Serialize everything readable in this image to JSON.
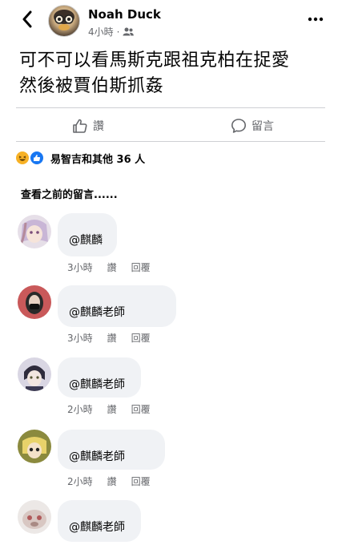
{
  "header": {
    "author": "Noah Duck",
    "time": "4小時",
    "privacy_icon": "friends-icon"
  },
  "post": {
    "text": "可不可以看馬斯克跟祖克柏在捉愛\n然後被賈伯斯抓姦"
  },
  "actions": {
    "like_label": "讚",
    "comment_label": "留言"
  },
  "reactions": {
    "icons": [
      "haha-icon",
      "like-icon"
    ],
    "text": "易智吉和其他 36 人"
  },
  "comments_section": {
    "view_previous": "查看之前的留言......"
  },
  "comments": [
    {
      "name": "",
      "text": "@麒麟",
      "time": "3小時",
      "like": "讚",
      "reply": "回覆"
    },
    {
      "name": "",
      "text": "@麒麟老師",
      "time": "3小時",
      "like": "讚",
      "reply": "回覆"
    },
    {
      "name": "",
      "text": "@麒麟老師",
      "time": "2小時",
      "like": "讚",
      "reply": "回覆"
    },
    {
      "name": "",
      "text": "@麒麟老師",
      "time": "2小時",
      "like": "讚",
      "reply": "回覆"
    },
    {
      "name": "",
      "text": "@麒麟老師",
      "time": "",
      "like": "",
      "reply": ""
    }
  ],
  "colors": {
    "text": "#050505",
    "secondary_text": "#65676b",
    "bubble": "#f0f2f5",
    "like_blue": "#1877f2",
    "haha_yellow": "#f7b125"
  }
}
